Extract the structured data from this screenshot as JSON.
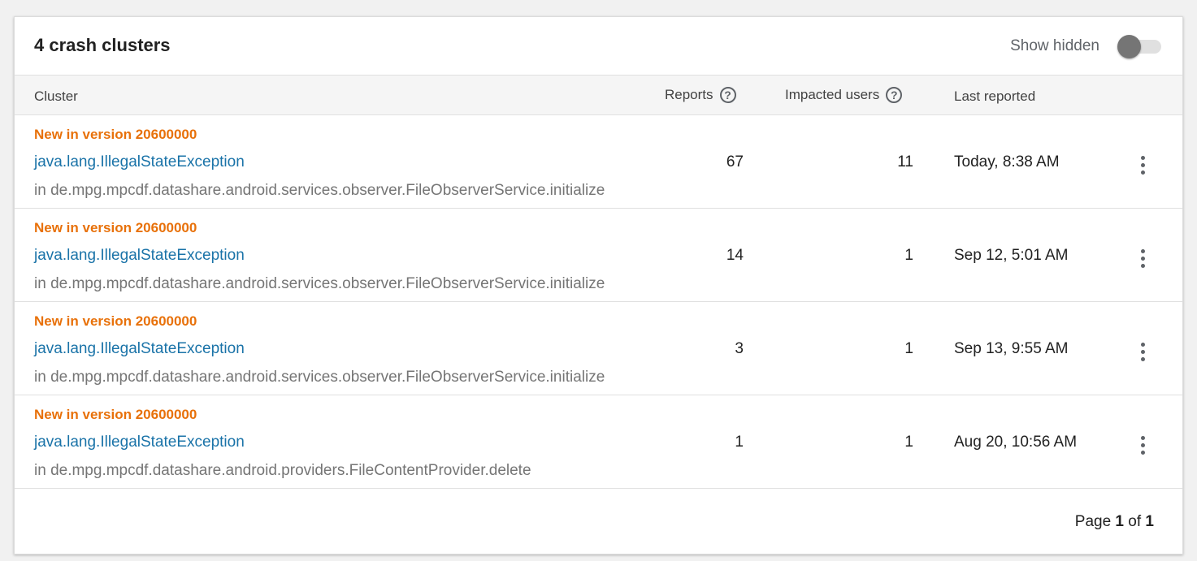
{
  "header": {
    "title": "4 crash clusters",
    "show_hidden_label": "Show hidden",
    "show_hidden_on": false
  },
  "columns": {
    "cluster": "Cluster",
    "reports": "Reports",
    "users": "Impacted users",
    "last_reported": "Last reported",
    "help_glyph": "?"
  },
  "rows": [
    {
      "badge": "New in version 20600000",
      "exception": "java.lang.IllegalStateException",
      "location": "in de.mpg.mpcdf.datashare.android.services.observer.FileObserverService.initialize",
      "reports": "67",
      "users": "11",
      "last_reported": "Today, 8:38 AM"
    },
    {
      "badge": "New in version 20600000",
      "exception": "java.lang.IllegalStateException",
      "location": "in de.mpg.mpcdf.datashare.android.services.observer.FileObserverService.initialize",
      "reports": "14",
      "users": "1",
      "last_reported": "Sep 12, 5:01 AM"
    },
    {
      "badge": "New in version 20600000",
      "exception": "java.lang.IllegalStateException",
      "location": "in de.mpg.mpcdf.datashare.android.services.observer.FileObserverService.initialize",
      "reports": "3",
      "users": "1",
      "last_reported": "Sep 13, 9:55 AM"
    },
    {
      "badge": "New in version 20600000",
      "exception": "java.lang.IllegalStateException",
      "location": "in de.mpg.mpcdf.datashare.android.providers.FileContentProvider.delete",
      "reports": "1",
      "users": "1",
      "last_reported": "Aug 20, 10:56 AM"
    }
  ],
  "pagination": {
    "prefix": "Page",
    "current": "1",
    "of": "of",
    "total": "1"
  },
  "colors": {
    "badge": "#e8710a",
    "link": "#1a73a8",
    "secondary_text": "#757575",
    "toggle_thumb": "#757575"
  }
}
